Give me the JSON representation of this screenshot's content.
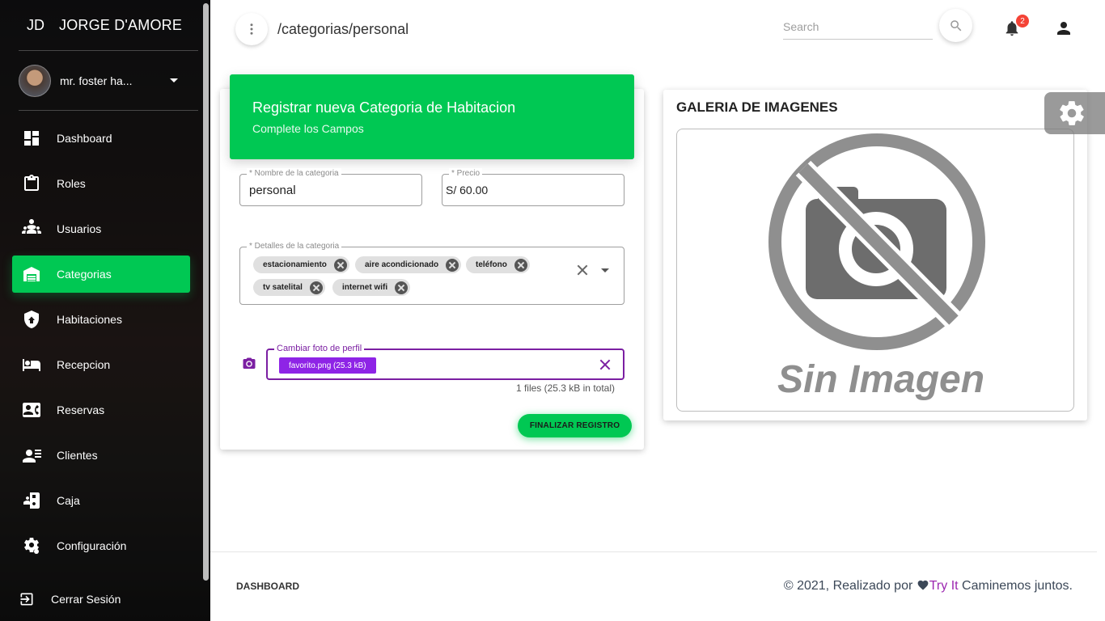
{
  "sidebar": {
    "brand_mini": "JD",
    "brand_full": "JORGE D'AMORE",
    "user_name": "mr. foster ha...",
    "items": [
      {
        "label": "Dashboard",
        "icon": "dashboard-icon"
      },
      {
        "label": "Roles",
        "icon": "clipboard-icon"
      },
      {
        "label": "Usuarios",
        "icon": "people-icon"
      },
      {
        "label": "Categorias",
        "icon": "garage-icon",
        "active": true
      },
      {
        "label": "Habitaciones",
        "icon": "shield-home-icon"
      },
      {
        "label": "Recepcion",
        "icon": "bed-icon"
      },
      {
        "label": "Reservas",
        "icon": "contact-card-icon"
      },
      {
        "label": "Clientes",
        "icon": "person-list-icon"
      },
      {
        "label": "Caja",
        "icon": "register-icon"
      },
      {
        "label": "Configuración",
        "icon": "settings-cog-icon"
      }
    ],
    "logout_label": "Cerrar Sesión"
  },
  "topbar": {
    "route": "/categorias/personal",
    "search_placeholder": "Search",
    "notification_count": "2"
  },
  "form": {
    "header_title": "Registrar nueva Categoria de Habitacion",
    "header_subtitle": "Complete los Campos",
    "name_label": "* Nombre de la categoria",
    "name_value": "personal",
    "price_label": "* Precio",
    "price_value": "S/ 60.00",
    "details_label": "* Detalles de la categoria",
    "chips": [
      "estacionamiento",
      "aire acondicionado",
      "teléfono",
      "tv satelital",
      "internet wifi"
    ],
    "file_label": "Cambiar foto de perfil",
    "file_chip": "favorito.png (25.3 kB)",
    "files_hint": "1 files (25.3 kB in total)",
    "submit_label": "FINALIZAR REGISTRO"
  },
  "gallery": {
    "title": "GALERIA DE IMAGENES",
    "placeholder_text": "Sin Imagen"
  },
  "footer": {
    "left": "DASHBOARD",
    "copyright": "© 2021, Realizado por",
    "link": "Try It",
    "tagline": "Caminemos juntos."
  },
  "colors": {
    "accent_green": "#00c853",
    "file_purple": "#7b1fa2",
    "badge_red": "#f44336",
    "link_purple": "#9c27b0"
  }
}
